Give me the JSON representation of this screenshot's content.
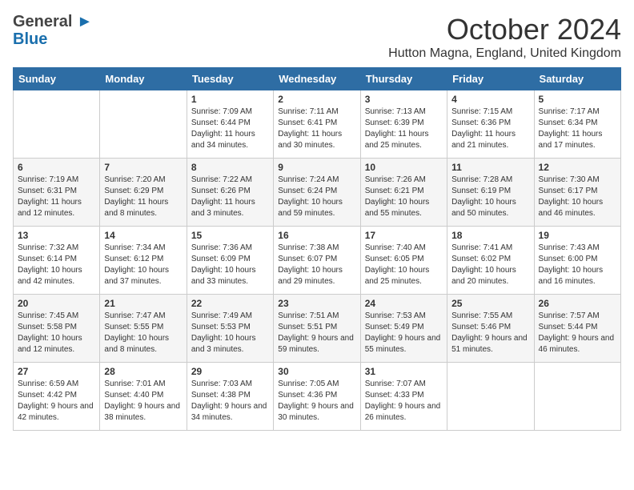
{
  "logo": {
    "line1": "General",
    "line2": "Blue"
  },
  "header": {
    "month": "October 2024",
    "location": "Hutton Magna, England, United Kingdom"
  },
  "weekdays": [
    "Sunday",
    "Monday",
    "Tuesday",
    "Wednesday",
    "Thursday",
    "Friday",
    "Saturday"
  ],
  "weeks": [
    [
      {
        "day": "",
        "info": ""
      },
      {
        "day": "",
        "info": ""
      },
      {
        "day": "1",
        "info": "Sunrise: 7:09 AM\nSunset: 6:44 PM\nDaylight: 11 hours and 34 minutes."
      },
      {
        "day": "2",
        "info": "Sunrise: 7:11 AM\nSunset: 6:41 PM\nDaylight: 11 hours and 30 minutes."
      },
      {
        "day": "3",
        "info": "Sunrise: 7:13 AM\nSunset: 6:39 PM\nDaylight: 11 hours and 25 minutes."
      },
      {
        "day": "4",
        "info": "Sunrise: 7:15 AM\nSunset: 6:36 PM\nDaylight: 11 hours and 21 minutes."
      },
      {
        "day": "5",
        "info": "Sunrise: 7:17 AM\nSunset: 6:34 PM\nDaylight: 11 hours and 17 minutes."
      }
    ],
    [
      {
        "day": "6",
        "info": "Sunrise: 7:19 AM\nSunset: 6:31 PM\nDaylight: 11 hours and 12 minutes."
      },
      {
        "day": "7",
        "info": "Sunrise: 7:20 AM\nSunset: 6:29 PM\nDaylight: 11 hours and 8 minutes."
      },
      {
        "day": "8",
        "info": "Sunrise: 7:22 AM\nSunset: 6:26 PM\nDaylight: 11 hours and 3 minutes."
      },
      {
        "day": "9",
        "info": "Sunrise: 7:24 AM\nSunset: 6:24 PM\nDaylight: 10 hours and 59 minutes."
      },
      {
        "day": "10",
        "info": "Sunrise: 7:26 AM\nSunset: 6:21 PM\nDaylight: 10 hours and 55 minutes."
      },
      {
        "day": "11",
        "info": "Sunrise: 7:28 AM\nSunset: 6:19 PM\nDaylight: 10 hours and 50 minutes."
      },
      {
        "day": "12",
        "info": "Sunrise: 7:30 AM\nSunset: 6:17 PM\nDaylight: 10 hours and 46 minutes."
      }
    ],
    [
      {
        "day": "13",
        "info": "Sunrise: 7:32 AM\nSunset: 6:14 PM\nDaylight: 10 hours and 42 minutes."
      },
      {
        "day": "14",
        "info": "Sunrise: 7:34 AM\nSunset: 6:12 PM\nDaylight: 10 hours and 37 minutes."
      },
      {
        "day": "15",
        "info": "Sunrise: 7:36 AM\nSunset: 6:09 PM\nDaylight: 10 hours and 33 minutes."
      },
      {
        "day": "16",
        "info": "Sunrise: 7:38 AM\nSunset: 6:07 PM\nDaylight: 10 hours and 29 minutes."
      },
      {
        "day": "17",
        "info": "Sunrise: 7:40 AM\nSunset: 6:05 PM\nDaylight: 10 hours and 25 minutes."
      },
      {
        "day": "18",
        "info": "Sunrise: 7:41 AM\nSunset: 6:02 PM\nDaylight: 10 hours and 20 minutes."
      },
      {
        "day": "19",
        "info": "Sunrise: 7:43 AM\nSunset: 6:00 PM\nDaylight: 10 hours and 16 minutes."
      }
    ],
    [
      {
        "day": "20",
        "info": "Sunrise: 7:45 AM\nSunset: 5:58 PM\nDaylight: 10 hours and 12 minutes."
      },
      {
        "day": "21",
        "info": "Sunrise: 7:47 AM\nSunset: 5:55 PM\nDaylight: 10 hours and 8 minutes."
      },
      {
        "day": "22",
        "info": "Sunrise: 7:49 AM\nSunset: 5:53 PM\nDaylight: 10 hours and 3 minutes."
      },
      {
        "day": "23",
        "info": "Sunrise: 7:51 AM\nSunset: 5:51 PM\nDaylight: 9 hours and 59 minutes."
      },
      {
        "day": "24",
        "info": "Sunrise: 7:53 AM\nSunset: 5:49 PM\nDaylight: 9 hours and 55 minutes."
      },
      {
        "day": "25",
        "info": "Sunrise: 7:55 AM\nSunset: 5:46 PM\nDaylight: 9 hours and 51 minutes."
      },
      {
        "day": "26",
        "info": "Sunrise: 7:57 AM\nSunset: 5:44 PM\nDaylight: 9 hours and 46 minutes."
      }
    ],
    [
      {
        "day": "27",
        "info": "Sunrise: 6:59 AM\nSunset: 4:42 PM\nDaylight: 9 hours and 42 minutes."
      },
      {
        "day": "28",
        "info": "Sunrise: 7:01 AM\nSunset: 4:40 PM\nDaylight: 9 hours and 38 minutes."
      },
      {
        "day": "29",
        "info": "Sunrise: 7:03 AM\nSunset: 4:38 PM\nDaylight: 9 hours and 34 minutes."
      },
      {
        "day": "30",
        "info": "Sunrise: 7:05 AM\nSunset: 4:36 PM\nDaylight: 9 hours and 30 minutes."
      },
      {
        "day": "31",
        "info": "Sunrise: 7:07 AM\nSunset: 4:33 PM\nDaylight: 9 hours and 26 minutes."
      },
      {
        "day": "",
        "info": ""
      },
      {
        "day": "",
        "info": ""
      }
    ]
  ]
}
